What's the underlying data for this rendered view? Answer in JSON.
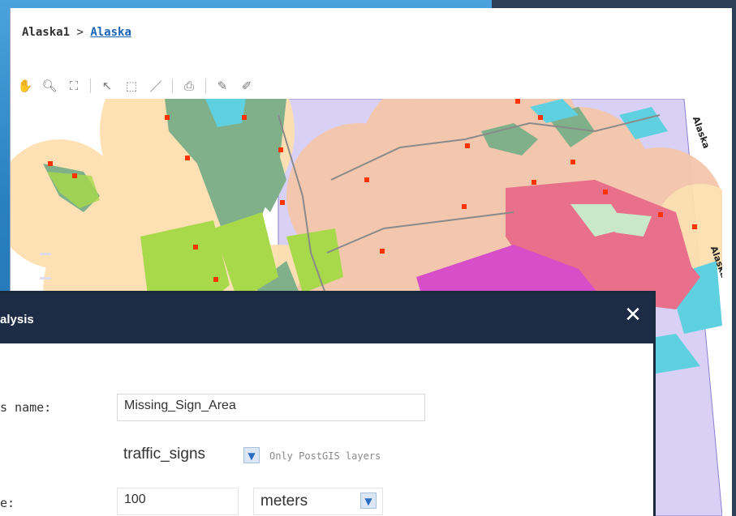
{
  "breadcrumb": {
    "parent": "Alaska1",
    "separator": ">",
    "current": "Alaska"
  },
  "toolbar": {
    "tools": [
      "pan-hand-icon",
      "zoom-icon",
      "full-extent-icon",
      "select-arrow-icon",
      "rectangle-select-icon",
      "measure-line-icon",
      "print-icon",
      "edit-pencil-icon",
      "edit-feature-icon"
    ]
  },
  "map": {
    "labels": [
      "Alaska",
      "Alaska"
    ],
    "colors": {
      "buffer": "#f5c7ab",
      "water": "#5fd0e0",
      "forest": "#7fb08a",
      "green": "#a7d94a",
      "magenta": "#d64fc8",
      "pink": "#e8708a",
      "point": "#ff3300",
      "state": "#d8d0f5"
    }
  },
  "dialog": {
    "title": "alysis",
    "close_label": "✕",
    "fields": {
      "name_label": "s name:",
      "name_value": "Missing_Sign_Area",
      "layer_value": "traffic_signs",
      "layer_hint": "Only PostGIS layers",
      "distance_label": "e:",
      "distance_value": "100",
      "unit_value": "meters"
    }
  }
}
